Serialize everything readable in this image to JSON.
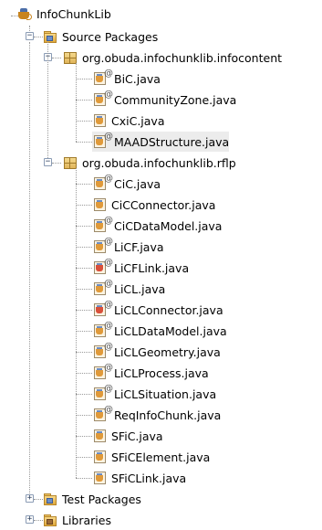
{
  "tree": {
    "project": "InfoChunkLib",
    "source_packages": "Source Packages",
    "packages": [
      {
        "name": "org.obuda.infochunklib.infocontent",
        "files": [
          {
            "name": "BiC.java",
            "annotated": true,
            "icon": "java-class-icon"
          },
          {
            "name": "CommunityZone.java",
            "annotated": true,
            "icon": "java-class-icon"
          },
          {
            "name": "CxiC.java",
            "annotated": false,
            "icon": "java-class-icon"
          },
          {
            "name": "MAADStructure.java",
            "annotated": true,
            "icon": "java-class-icon",
            "selected": true
          }
        ]
      },
      {
        "name": "org.obuda.infochunklib.rflp",
        "files": [
          {
            "name": "CiC.java",
            "annotated": true,
            "icon": "java-class-icon"
          },
          {
            "name": "CiCConnector.java",
            "annotated": false,
            "icon": "java-class-icon"
          },
          {
            "name": "CiCDataModel.java",
            "annotated": true,
            "icon": "java-class-icon"
          },
          {
            "name": "LiCF.java",
            "annotated": true,
            "icon": "java-class-icon"
          },
          {
            "name": "LiCFLink.java",
            "annotated": true,
            "icon": "java-connector-icon"
          },
          {
            "name": "LiCL.java",
            "annotated": true,
            "icon": "java-class-icon"
          },
          {
            "name": "LiCLConnector.java",
            "annotated": true,
            "icon": "java-connector-icon"
          },
          {
            "name": "LiCLDataModel.java",
            "annotated": true,
            "icon": "java-class-icon"
          },
          {
            "name": "LiCLGeometry.java",
            "annotated": true,
            "icon": "java-class-icon"
          },
          {
            "name": "LiCLProcess.java",
            "annotated": true,
            "icon": "java-class-icon"
          },
          {
            "name": "LiCLSituation.java",
            "annotated": true,
            "icon": "java-class-icon"
          },
          {
            "name": "ReqInfoChunk.java",
            "annotated": true,
            "icon": "java-class-icon"
          },
          {
            "name": "SFiC.java",
            "annotated": false,
            "icon": "java-class-icon"
          },
          {
            "name": "SFiCElement.java",
            "annotated": false,
            "icon": "java-class-icon"
          },
          {
            "name": "SFiCLink.java",
            "annotated": false,
            "icon": "java-class-icon"
          }
        ]
      }
    ],
    "test_packages": "Test Packages",
    "libraries": "Libraries",
    "expand_symbol": "−",
    "collapse_symbol": "+",
    "annotation_symbol": "@"
  }
}
